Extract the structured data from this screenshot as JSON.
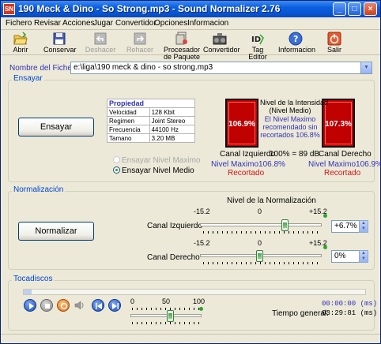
{
  "window": {
    "title": "190 Meck & Dino - So Strong.mp3 - Sound Normalizer 2.76",
    "icon_text": "SN",
    "controls": [
      "_",
      "□",
      "×"
    ]
  },
  "menu": [
    "Fichero",
    "Revisar",
    "Acciones",
    "Jugar",
    "Convertidor",
    "Opciones",
    "Informacion"
  ],
  "toolbar": [
    {
      "label": "Abrir",
      "icon": "open-folder-icon",
      "enabled": true
    },
    {
      "label": "Conservar",
      "icon": "save-disk-icon",
      "enabled": true
    },
    {
      "label": "Deshacer",
      "icon": "undo-icon",
      "enabled": false
    },
    {
      "label": "Rehacer",
      "icon": "redo-icon",
      "enabled": false
    },
    {
      "label": "Procesador de Paquete",
      "icon": "batch-processor-icon",
      "enabled": true
    },
    {
      "label": "Convertidor",
      "icon": "converter-icon",
      "enabled": true
    },
    {
      "label": "Tag Editor",
      "icon": "tag-editor-icon",
      "enabled": true
    },
    {
      "label": "Informacion",
      "icon": "info-icon",
      "enabled": true
    },
    {
      "label": "Salir",
      "icon": "exit-icon",
      "enabled": true
    }
  ],
  "file": {
    "label": "Nombre del Fichero:",
    "value": "e:\\liga\\190 meck & dino - so strong.mp3"
  },
  "ensayar": {
    "group_title": "Ensayar",
    "button": "Ensayar",
    "properties": {
      "header": "Propiedad",
      "rows": [
        {
          "key": "Velocidad",
          "value": "128 Kbit"
        },
        {
          "key": "Regimen",
          "value": "Joint Stereo"
        },
        {
          "key": "Frecuencia",
          "value": "44100 Hz"
        },
        {
          "key": "Tamano",
          "value": "3.20 MB"
        }
      ]
    },
    "radio_max": "Ensayar Nivel Maximo",
    "radio_medio": "Ensayar Nivel Medio",
    "left_meter": "106.9%",
    "right_meter": "107.3%",
    "intensity_title_1": "Nivel de la Intensidad",
    "intensity_title_2": "(Nivel Medio)",
    "recommend_1": "El Nivel Maximo",
    "recommend_2": "recomendado sin",
    "recommend_3": "recortados 106.8%",
    "left_label": "Canal Izquierdo",
    "db_label": "100% = 89 dB",
    "right_label": "Canal Derecho",
    "left_max": "Nivel Maximo106.8%",
    "right_max": "Nivel Maximo106.9%",
    "left_clip": "Recortado",
    "right_clip": "Recortado"
  },
  "normalizacion": {
    "group_title": "Normalización",
    "button": "Normalizar",
    "title": "Nivel de la Normalización",
    "scale_min": "-15.2",
    "scale_mid": "0",
    "scale_max": "+15.2",
    "left_label": "Canal Izquierdo",
    "left_value": "+6.7%",
    "right_label": "Canal Derecho",
    "right_value": "0%"
  },
  "tocadiscos": {
    "group_title": "Tocadiscos",
    "vol_0": "0",
    "vol_50": "50",
    "vol_100": "100",
    "time_current": "00:00:00 (ms)",
    "time_total_label": "Tiempo general:",
    "time_total": "03:29:81 (ms)"
  }
}
